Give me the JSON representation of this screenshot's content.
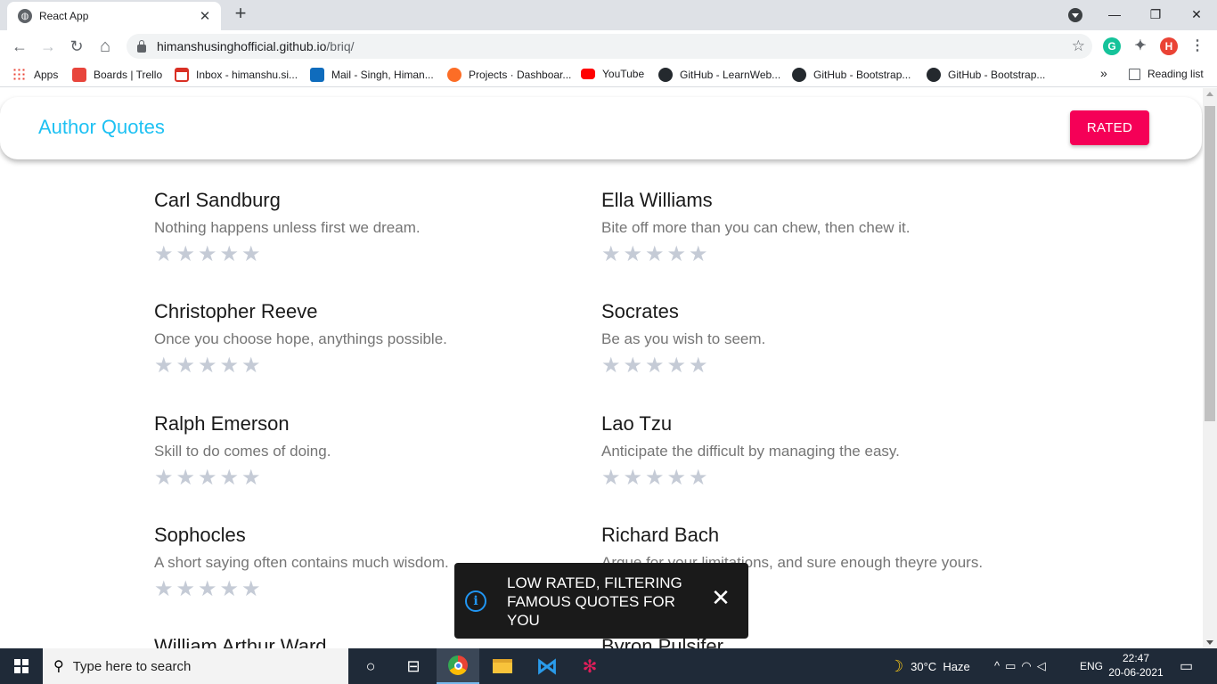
{
  "browser": {
    "tab_title": "React App",
    "tab_close": "✕",
    "new_tab": "+",
    "window_controls": {
      "minimize": "—",
      "restore": "❐",
      "close": "✕"
    },
    "nav": {
      "back": "←",
      "forward": "→",
      "reload": "↻",
      "home": "⌂"
    },
    "url_host": "himanshusinghofficial.github.io",
    "url_path": "/briq/",
    "bookmark_star": "☆",
    "extensions": [
      {
        "name": "grammarly",
        "label": "G",
        "color": "#15c39a"
      },
      {
        "name": "profile",
        "label": "H",
        "color": "#ea4335"
      }
    ],
    "menu": "⋮"
  },
  "bookmarks": {
    "items": [
      {
        "label": "Apps",
        "color": "#ea4335"
      },
      {
        "label": "Boards | Trello",
        "color": "#e8453c"
      },
      {
        "label": "Inbox - himanshu.si...",
        "color": "#d93025"
      },
      {
        "label": "Mail - Singh, Himan...",
        "color": "#0f6cbd"
      },
      {
        "label": "Projects · Dashboar...",
        "color": "#fc6d26"
      },
      {
        "label": "YouTube",
        "color": "#ff0000"
      },
      {
        "label": "GitHub - LearnWeb...",
        "color": "#24292e"
      },
      {
        "label": "GitHub - Bootstrap...",
        "color": "#24292e"
      },
      {
        "label": "GitHub - Bootstrap...",
        "color": "#24292e"
      }
    ],
    "overflow": "»",
    "reading_list": "Reading list"
  },
  "app": {
    "title": "Author Quotes",
    "rated_button": "RATED",
    "accent_color": "#1ec1f3",
    "button_color": "#f50057"
  },
  "quotes": [
    {
      "author": "Carl Sandburg",
      "text": "Nothing happens unless first we dream.",
      "rating": 0
    },
    {
      "author": "Ella Williams",
      "text": "Bite off more than you can chew, then chew it.",
      "rating": 0
    },
    {
      "author": "Christopher Reeve",
      "text": "Once you choose hope, anythings possible.",
      "rating": 0
    },
    {
      "author": "Socrates",
      "text": "Be as you wish to seem.",
      "rating": 0
    },
    {
      "author": "Ralph Emerson",
      "text": "Skill to do comes of doing.",
      "rating": 0
    },
    {
      "author": "Lao Tzu",
      "text": "Anticipate the difficult by managing the easy.",
      "rating": 0
    },
    {
      "author": "Sophocles",
      "text": "A short saying often contains much wisdom.",
      "rating": 0
    },
    {
      "author": "Richard Bach",
      "text": "Argue for your limitations, and sure enough theyre yours.",
      "rating": 0
    },
    {
      "author": "William Arthur Ward",
      "text": "",
      "rating": 0
    },
    {
      "author": "Byron Pulsifer",
      "text": "",
      "rating": 0
    }
  ],
  "star_glyph": "★",
  "snackbar": {
    "message": "LOW RATED, FILTERING FAMOUS QUOTES FOR YOU",
    "icon": "i",
    "close": "✕"
  },
  "taskbar": {
    "search_placeholder": "Type here to search",
    "weather": "30°C  Haze",
    "language": "ENG",
    "time": "22:47",
    "date": "20-06-2021"
  }
}
